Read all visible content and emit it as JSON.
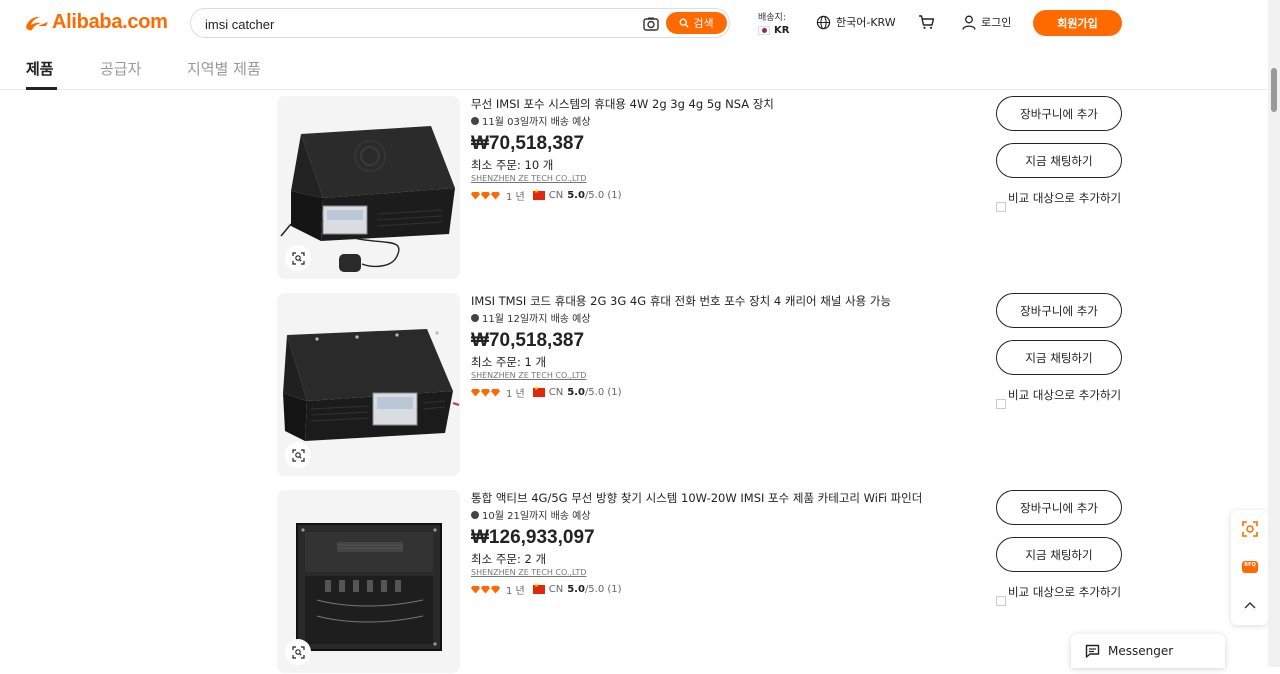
{
  "header": {
    "logo_text": "Alibaba.com",
    "search_value": "imsi catcher",
    "search_button": "검색",
    "ship_label": "배송지:",
    "ship_country": "KR",
    "language": "한국어-KRW",
    "login": "로그인",
    "signup": "회원가입",
    "accent_color": "#ff6a00"
  },
  "tabs": [
    {
      "label": "제품",
      "active": true
    },
    {
      "label": "공급자",
      "active": false
    },
    {
      "label": "지역별 제품",
      "active": false
    }
  ],
  "products": [
    {
      "title": "무선 IMSI 포수 시스템의 휴대용 4W 2g 3g 4g 5g NSA 장치",
      "delivery": "11월 03일까지 배송 예상",
      "price": "₩70,518,387",
      "moq": "최소 주문: 10 개",
      "supplier": "SHENZHEN ZE TECH CO.,LTD",
      "years": "1 년",
      "country": "CN",
      "rating": "5.0",
      "rating_suffix": "/5.0 (1)",
      "add_to_cart": "장바구니에 추가",
      "chat_now": "지금 채팅하기",
      "compare": "비교 대상으로 추가하기"
    },
    {
      "title": "IMSI TMSI 코드 휴대용 2G 3G 4G 휴대 전화 번호 포수 장치 4 캐리어 채널 사용 가능",
      "delivery": "11월 12일까지 배송 예상",
      "price": "₩70,518,387",
      "moq": "최소 주문: 1 개",
      "supplier": "SHENZHEN ZE TECH CO.,LTD",
      "years": "1 년",
      "country": "CN",
      "rating": "5.0",
      "rating_suffix": "/5.0 (1)",
      "add_to_cart": "장바구니에 추가",
      "chat_now": "지금 채팅하기",
      "compare": "비교 대상으로 추가하기"
    },
    {
      "title": "통합 액티브 4G/5G 무선 방향 찾기 시스템 10W-20W IMSI 포수 제품 카테고리 WiFi 파인더",
      "delivery": "10월 21일까지 배송 예상",
      "price": "₩126,933,097",
      "moq": "최소 주문: 2 개",
      "supplier": "SHENZHEN ZE TECH CO.,LTD",
      "years": "1 년",
      "country": "CN",
      "rating": "5.0",
      "rating_suffix": "/5.0 (1)",
      "add_to_cart": "장바구니에 추가",
      "chat_now": "지금 채팅하기",
      "compare": "비교 대상으로 추가하기"
    }
  ],
  "floating": {
    "rfq_label": "RFQ",
    "messenger": "Messenger"
  }
}
